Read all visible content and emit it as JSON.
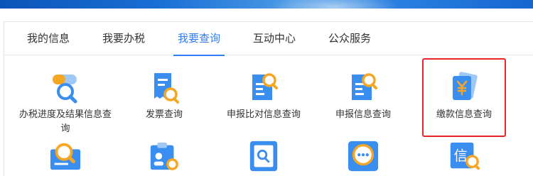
{
  "tabs": [
    {
      "label": "我的信息",
      "active": false
    },
    {
      "label": "我要办税",
      "active": false
    },
    {
      "label": "我要查询",
      "active": true
    },
    {
      "label": "互动中心",
      "active": false
    },
    {
      "label": "公众服务",
      "active": false
    }
  ],
  "query_items": [
    {
      "label": "办税进度及结果信息查询",
      "icon": "progress-search-icon"
    },
    {
      "label": "发票查询",
      "icon": "invoice-search-icon"
    },
    {
      "label": "申报比对信息查询",
      "icon": "declaration-compare-icon"
    },
    {
      "label": "申报信息查询",
      "icon": "declaration-info-icon"
    },
    {
      "label": "缴款信息查询",
      "icon": "payment-info-icon"
    }
  ],
  "colors": {
    "accent": "#2f7cf6",
    "icon_blue": "#3a8ef0",
    "icon_orange": "#f5a623",
    "highlight_red": "#e8262a"
  }
}
